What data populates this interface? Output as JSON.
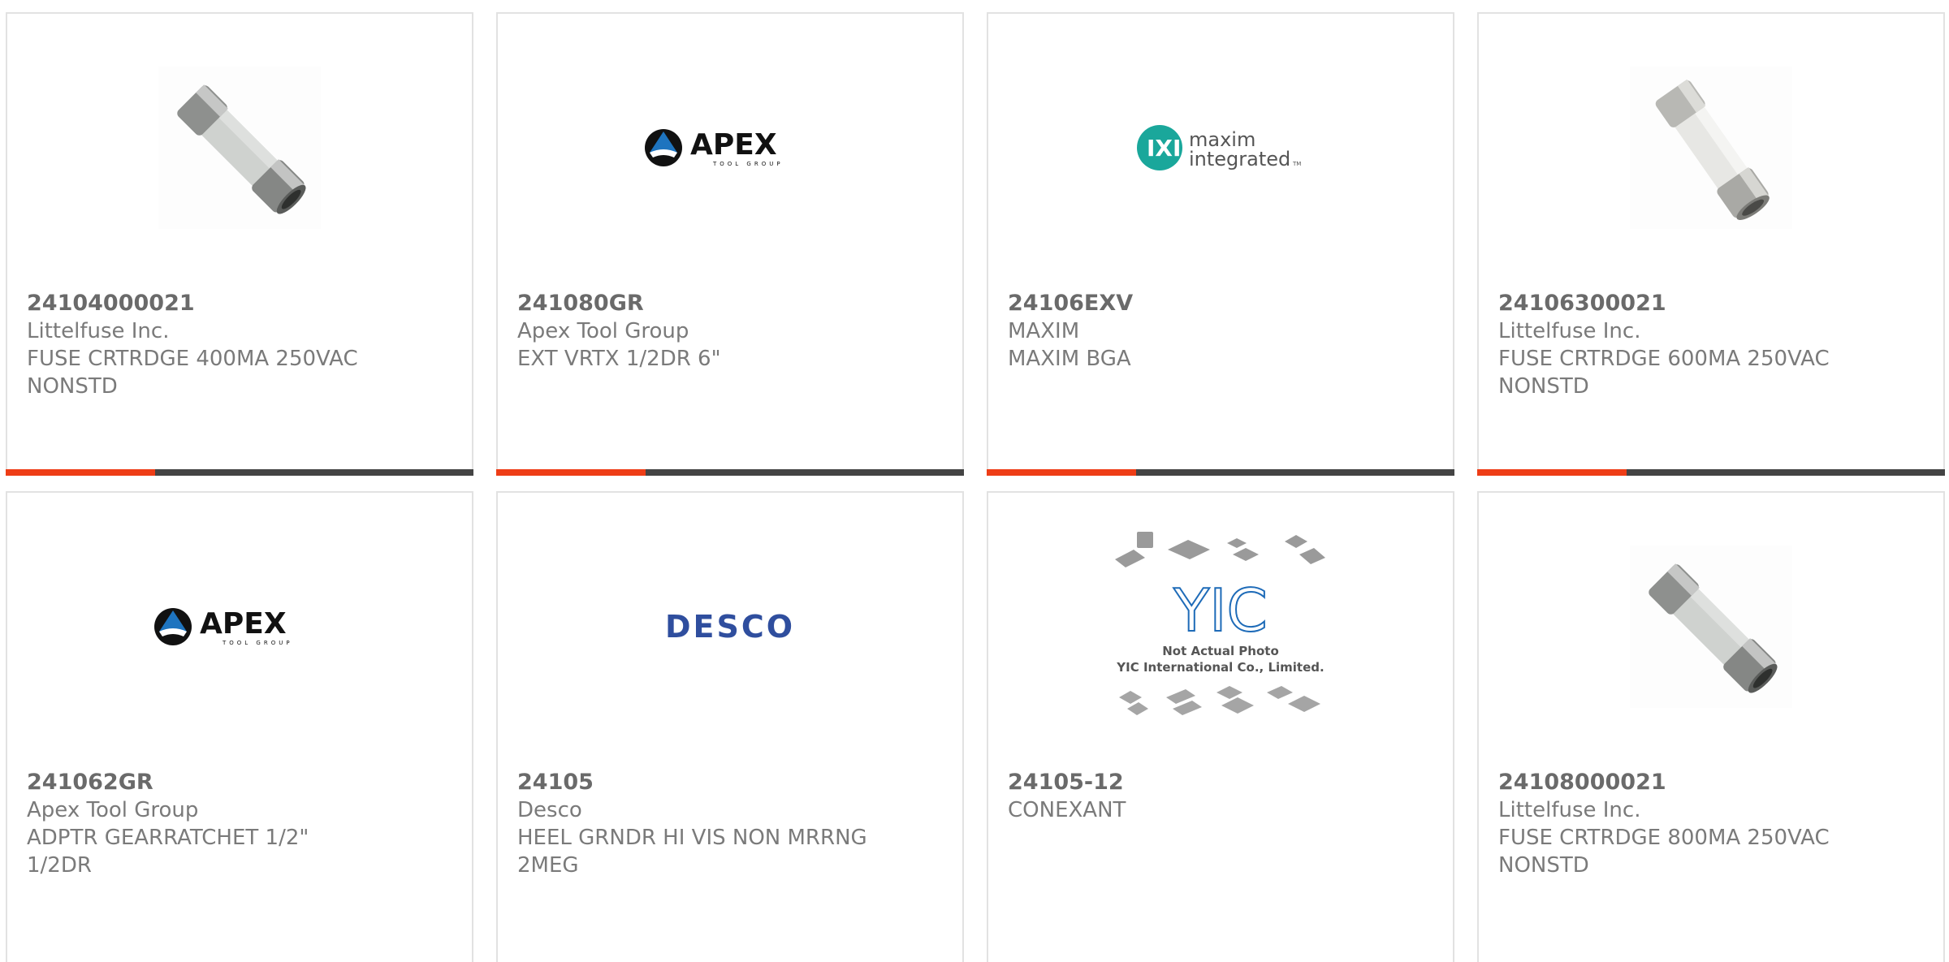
{
  "cards": [
    {
      "part": "24104000021",
      "manufacturer": "Littelfuse Inc.",
      "desc1": "FUSE CRTRDGE 400MA 250VAC",
      "desc2": "NONSTD",
      "image": "fuse-icon"
    },
    {
      "part": "241080GR",
      "manufacturer": "Apex Tool Group",
      "desc1": "EXT VRTX 1/2DR 6\"",
      "desc2": "",
      "image": "apex-logo",
      "logo_text": "APEX",
      "logo_sub": "TOOL GROUP"
    },
    {
      "part": "24106EXV",
      "manufacturer": "MAXIM",
      "desc1": "MAXIM BGA",
      "desc2": "",
      "image": "maxim-logo",
      "logo_text1": "maxim",
      "logo_text2": "integrated",
      "logo_tm": "TM"
    },
    {
      "part": "24106300021",
      "manufacturer": "Littelfuse Inc.",
      "desc1": "FUSE CRTRDGE 600MA 250VAC",
      "desc2": "NONSTD",
      "image": "fuse-icon"
    },
    {
      "part": "241062GR",
      "manufacturer": "Apex Tool Group",
      "desc1": "ADPTR GEARRATCHET 1/2\"",
      "desc2": "1/2DR",
      "image": "apex-logo",
      "logo_text": "APEX",
      "logo_sub": "TOOL GROUP"
    },
    {
      "part": "24105",
      "manufacturer": "Desco",
      "desc1": "HEEL GRNDR HI VIS NON MRRNG",
      "desc2": "2MEG",
      "image": "desco-logo",
      "logo_text": "DESCO"
    },
    {
      "part": "24105-12",
      "manufacturer": "CONEXANT",
      "desc1": "",
      "desc2": "",
      "image": "yic-placeholder",
      "logo_text": "YIC",
      "note1": "Not Actual Photo",
      "note2": "YIC International Co., Limited."
    },
    {
      "part": "24108000021",
      "manufacturer": "Littelfuse Inc.",
      "desc1": "FUSE CRTRDGE 800MA 250VAC",
      "desc2": "NONSTD",
      "image": "fuse-icon"
    }
  ],
  "colors": {
    "accent": "#ee3d16",
    "bar": "#444444",
    "text": "#6a6a6a",
    "border": "#e2e2e2"
  }
}
